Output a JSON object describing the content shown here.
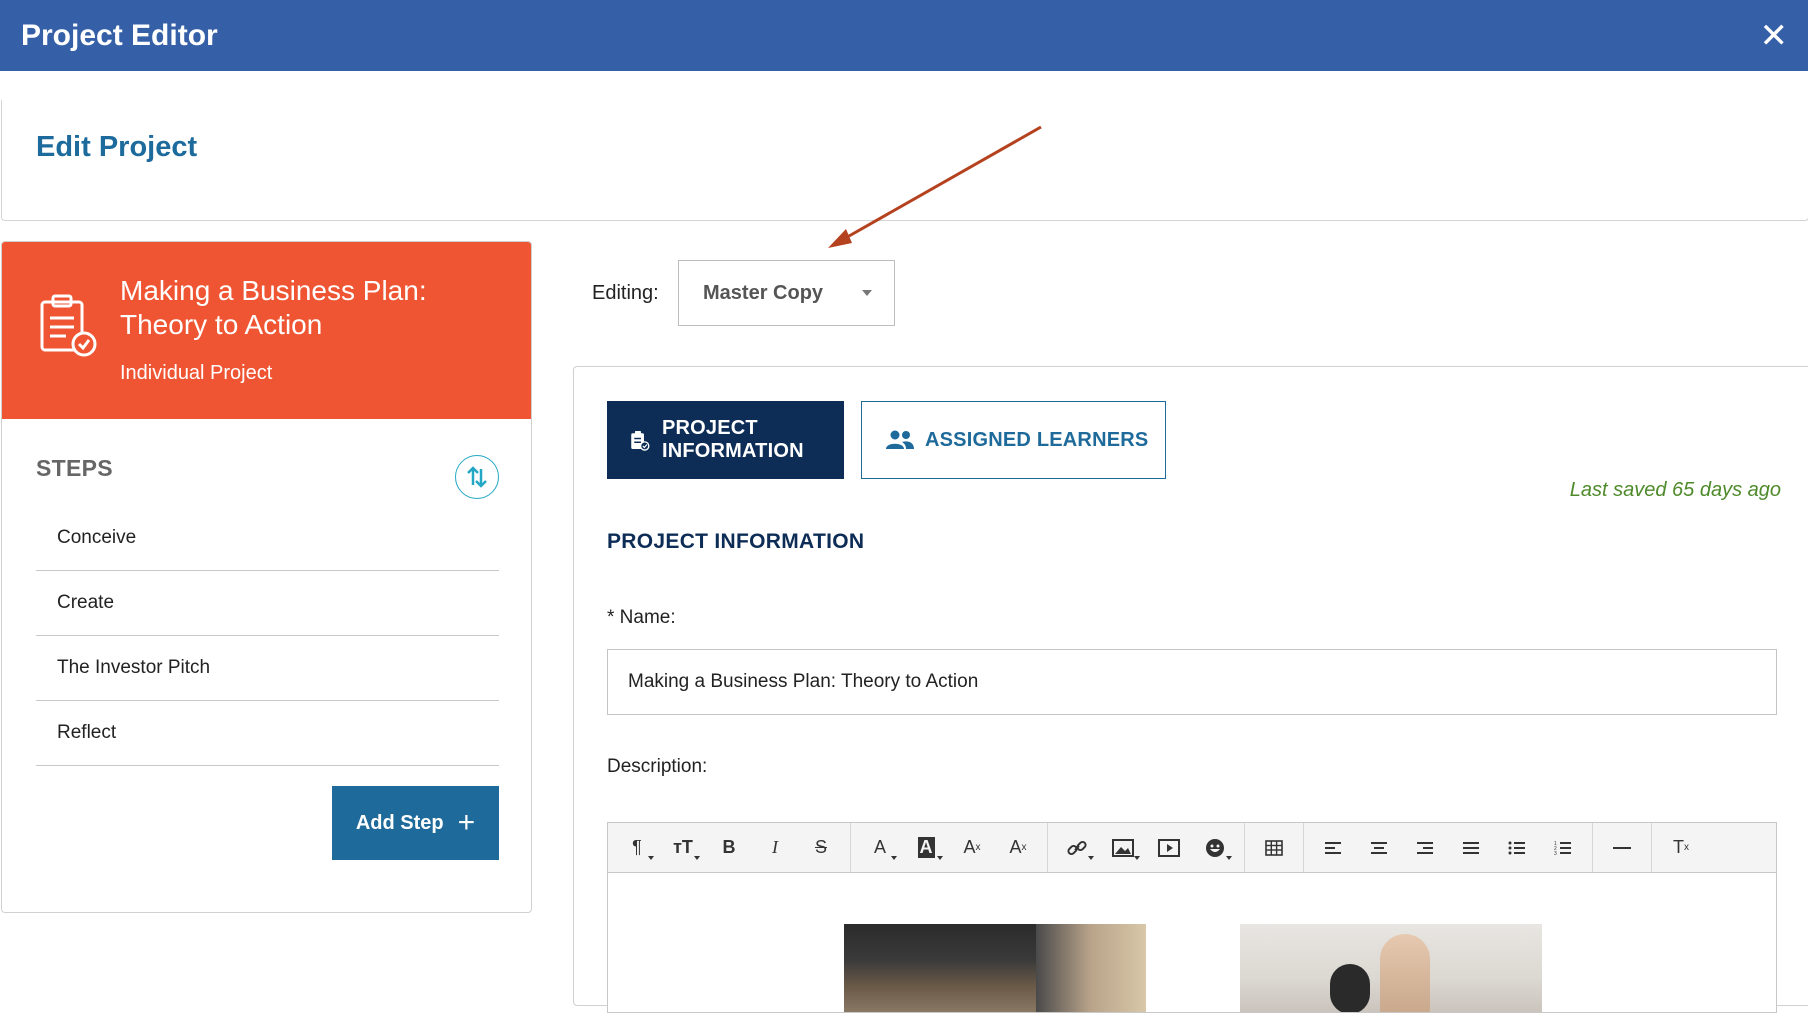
{
  "window": {
    "title": "Project Editor",
    "close_glyph": "✕"
  },
  "header": {
    "title": "Edit Project"
  },
  "project": {
    "title": "Making a Business Plan: Theory to Action",
    "type": "Individual Project",
    "banner_color": "#ef5533",
    "icon": "clipboard-check-icon"
  },
  "steps": {
    "title": "STEPS",
    "items": [
      {
        "label": "Conceive"
      },
      {
        "label": "Create"
      },
      {
        "label": "The Investor Pitch"
      },
      {
        "label": "Reflect"
      }
    ],
    "add_label": "Add Step"
  },
  "editing": {
    "label": "Editing:",
    "selected": "Master Copy"
  },
  "tabs": [
    {
      "label": "PROJECT INFORMATION",
      "icon": "clipboard-check-icon",
      "active": true
    },
    {
      "label": "ASSIGNED LEARNERS",
      "icon": "people-icon",
      "active": false
    }
  ],
  "status": {
    "last_saved": "Last saved 65 days ago"
  },
  "form": {
    "section_title": "PROJECT INFORMATION",
    "name_label": "* Name:",
    "name_value": "Making a Business Plan: Theory to Action",
    "description_label": "Description:"
  },
  "toolbar": {
    "buttons": [
      "paragraph-format-icon",
      "font-size-icon",
      "bold-icon",
      "italic-icon",
      "strikethrough-icon",
      "text-color-icon",
      "background-color-icon",
      "superscript-icon",
      "subscript-icon",
      "link-icon",
      "image-icon",
      "video-icon",
      "emoji-icon",
      "table-icon",
      "align-left-icon",
      "align-center-icon",
      "align-right-icon",
      "align-justify-icon",
      "bullet-list-icon",
      "numbered-list-icon",
      "horizontal-line-icon",
      "clear-formatting-icon"
    ]
  },
  "colors": {
    "topbar": "#3560a8",
    "accent": "#1e6a9a",
    "navy": "#0d2d56",
    "saved": "#4e8a2a"
  }
}
